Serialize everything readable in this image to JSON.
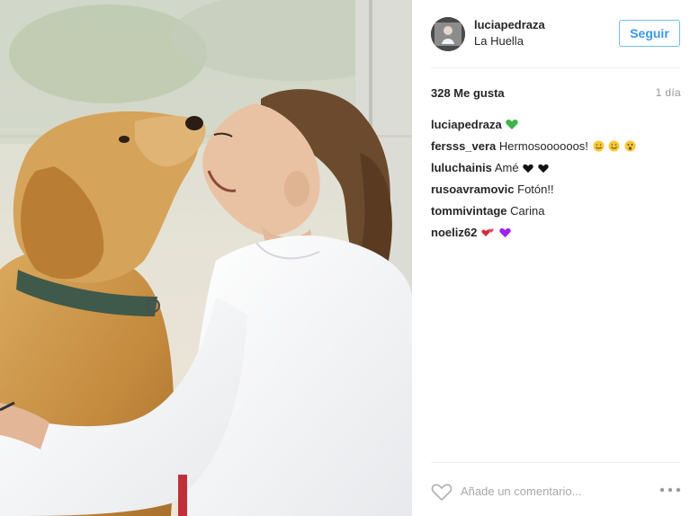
{
  "post": {
    "photo_alt": "",
    "author": {
      "username": "luciapedraza",
      "location": "La Huella",
      "follow_label": "Seguir"
    },
    "likes_text": "328 Me gusta",
    "time_ago": "1 día",
    "comments": [
      {
        "user": "luciapedraza",
        "text": "",
        "emoji": [
          "green-heart"
        ]
      },
      {
        "user": "fersss_vera",
        "text": "Hermosoooooos!",
        "emoji": [
          "smiling-face",
          "smiling-face",
          "astonished-face"
        ]
      },
      {
        "user": "luluchainis",
        "text": "Amé",
        "emoji": [
          "black-heart",
          "black-heart"
        ]
      },
      {
        "user": "rusoavramovic",
        "text": "Fotón!!",
        "emoji": []
      },
      {
        "user": "tommivintage",
        "text": "Carina",
        "emoji": []
      },
      {
        "user": "noeliz62",
        "text": "",
        "emoji": [
          "revolving-hearts",
          "purple-heart"
        ]
      }
    ],
    "comment_placeholder": "Añade un comentario...",
    "more_options_icon": "ellipsis-icon",
    "like_icon": "heart-outline-icon",
    "colors": {
      "follow_border": "#70c0e8",
      "follow_text": "#3897f0",
      "divider": "#efefef",
      "muted_text": "#999999",
      "green_heart": "#3bb54a",
      "purple_heart": "#a020f0",
      "red_heart": "#d42a3c"
    }
  }
}
